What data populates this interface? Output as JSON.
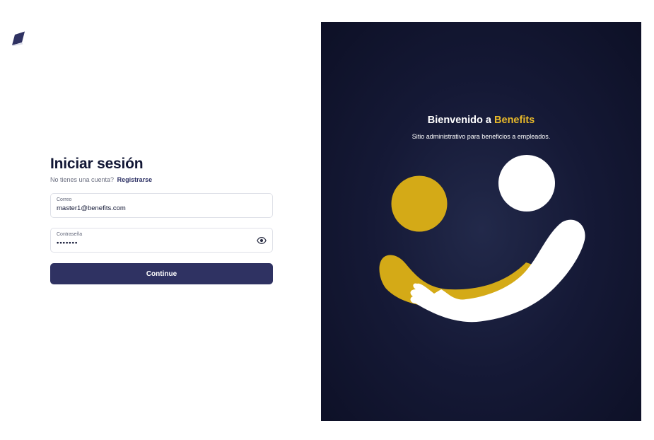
{
  "logo": {
    "icon": "benefits-logo-icon",
    "color": "#2f3262"
  },
  "login": {
    "title": "Iniciar sesión",
    "no_account_text": "No tienes una cuenta?",
    "register_link": "Registrarse",
    "email": {
      "label": "Correo",
      "value": "master1@benefits.com"
    },
    "password": {
      "label": "Contraseña",
      "value": "•••••••",
      "toggle_icon": "eye-icon"
    },
    "continue_label": "Continue"
  },
  "hero": {
    "welcome_prefix": "Bienvenido a ",
    "brand_name": "Benefits",
    "tagline": "Sitio administrativo para beneficios a empleados.",
    "colors": {
      "background": "#141836",
      "accent": "#d4aa17",
      "white": "#ffffff"
    }
  }
}
